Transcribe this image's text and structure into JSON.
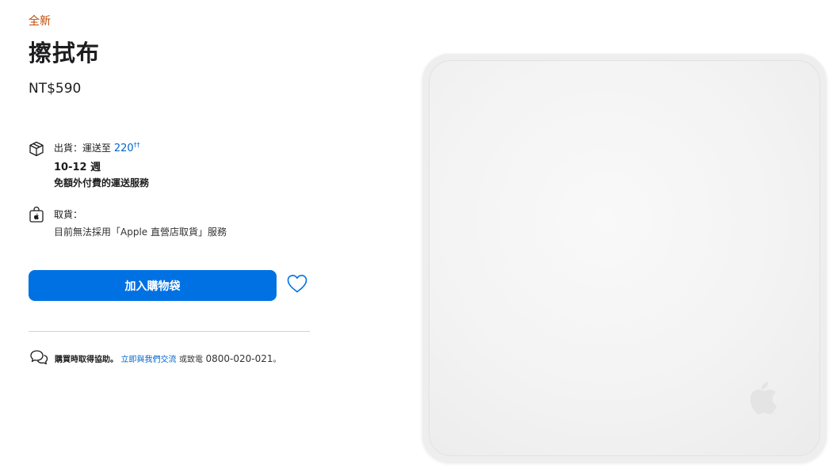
{
  "product": {
    "badge": "全新",
    "title": "擦拭布",
    "price": "NT$590"
  },
  "shipping": {
    "icon": "package-icon",
    "label": "出貨：運送至",
    "zip": "220",
    "zip_marker": "††",
    "eta": "10-12 週",
    "free_note": "免額外付費的運送服務"
  },
  "pickup": {
    "icon": "bag-icon",
    "label": "取貨：",
    "note": "目前無法採用「Apple 直營店取貨」服務"
  },
  "actions": {
    "add_to_bag": "加入購物袋",
    "favorite_icon": "heart-icon"
  },
  "help": {
    "icon": "chat-bubbles-icon",
    "lead": "購買時取得協助。",
    "chat_link": "立即與我們交流",
    "or_call": "或致電",
    "phone": "0800-020-021",
    "end": "。"
  },
  "colors": {
    "accent": "#0071e3",
    "link": "#0066cc",
    "badge": "#bf4800"
  }
}
